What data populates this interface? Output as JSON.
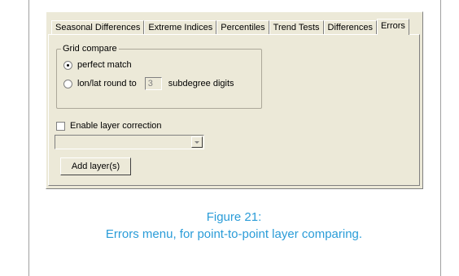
{
  "tabs": [
    {
      "label": "Seasonal Differences"
    },
    {
      "label": "Extreme Indices"
    },
    {
      "label": "Percentiles"
    },
    {
      "label": "Trend Tests"
    },
    {
      "label": "Differences"
    },
    {
      "label": "Errors",
      "active": true
    }
  ],
  "grid_compare": {
    "legend": "Grid compare",
    "option_perfect": "perfect match",
    "option_round": "lon/lat round to",
    "digits_value": "3",
    "digits_suffix": "subdegree digits",
    "selected": "perfect match"
  },
  "layer_correction": {
    "label": "Enable layer correction",
    "checked": false,
    "dropdown_value": ""
  },
  "add_layer_button": "Add layer(s)",
  "caption": {
    "line1": "Figure 21:",
    "line2": "Errors menu, for point-to-point layer comparing."
  },
  "colors": {
    "caption": "#2a9cd8",
    "dialog_bg": "#ece9d8"
  }
}
